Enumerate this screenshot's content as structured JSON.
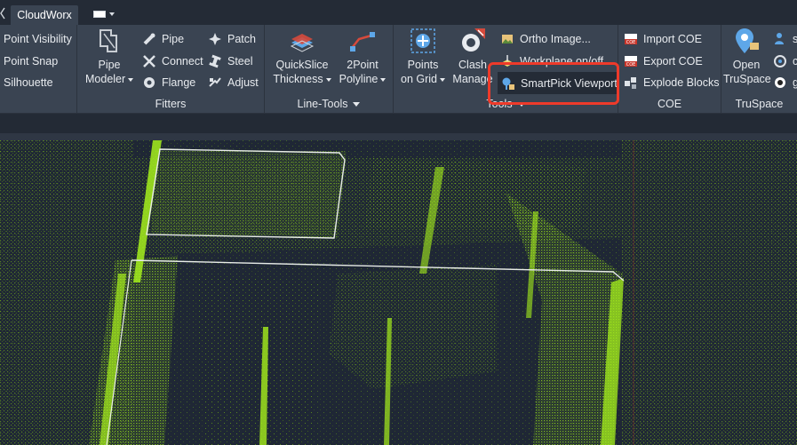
{
  "tabs": {
    "active": "CloudWorx"
  },
  "ribbon": {
    "point_panel": {
      "items": [
        "Point Visibility",
        "Point Snap",
        "Silhouette"
      ]
    },
    "fitters": {
      "title": "Fitters",
      "pipe_modeler": [
        "Pipe",
        "Modeler"
      ],
      "col1": [
        {
          "label": "Pipe",
          "icon": "pipe-icon"
        },
        {
          "label": "Connect",
          "icon": "connect-icon"
        },
        {
          "label": "Flange",
          "icon": "flange-icon"
        }
      ],
      "col2": [
        {
          "label": "Patch",
          "icon": "patch-icon"
        },
        {
          "label": "Steel",
          "icon": "steel-icon"
        },
        {
          "label": "Adjust",
          "icon": "adjust-icon"
        }
      ]
    },
    "line_tools": {
      "title": "Line-Tools",
      "quickslice": [
        "QuickSlice",
        "Thickness"
      ],
      "twopoint": [
        "2Point",
        "Polyline"
      ]
    },
    "tools": {
      "title": "Tools",
      "points_on_grid": [
        "Points",
        "on Grid"
      ],
      "clash": [
        "Clash",
        "Manage"
      ],
      "list": [
        {
          "label": "Ortho Image...",
          "icon": "ortho-image-icon"
        },
        {
          "label": "Workplane on/off",
          "icon": "workplane-icon"
        },
        {
          "label": "SmartPick Viewport",
          "icon": "smartpick-viewport-icon"
        }
      ]
    },
    "coe": {
      "title": "COE",
      "list": [
        {
          "label": "Import COE",
          "icon": "import-coe-icon"
        },
        {
          "label": "Export COE",
          "icon": "export-coe-icon"
        },
        {
          "label": "Explode Blocks",
          "icon": "explode-blocks-icon"
        }
      ]
    },
    "truspace": {
      "title": "TruSpace",
      "open": [
        "Open",
        "TruSpace"
      ],
      "icons": [
        "s",
        "c",
        "g"
      ]
    }
  },
  "colors": {
    "ribbon_bg": "#3a4452",
    "viewport_bg": "#1f2735",
    "point_cloud": "#9be21a",
    "highlight": "#ee3a2a"
  }
}
